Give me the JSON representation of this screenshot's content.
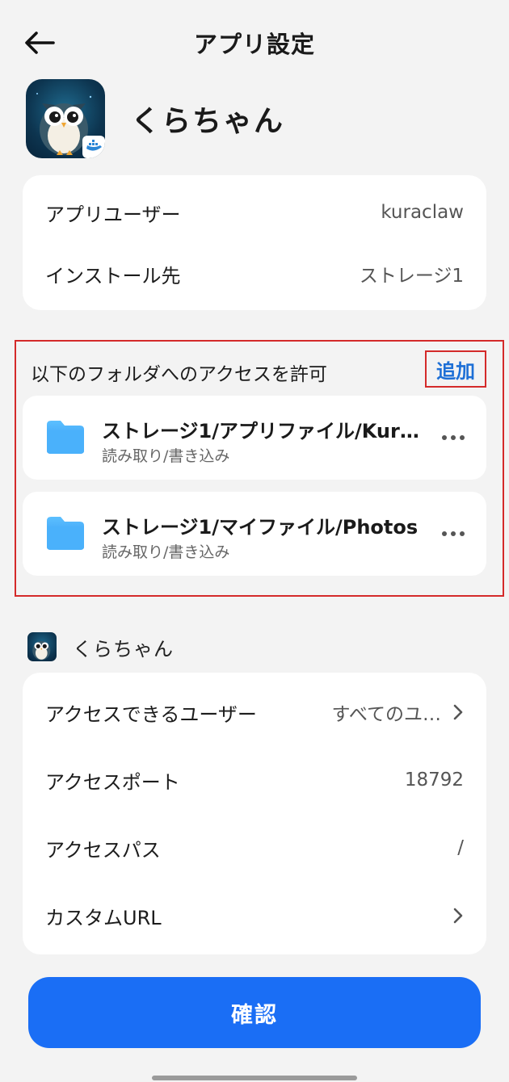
{
  "header": {
    "title": "アプリ設定",
    "back_icon": "arrow-left-icon"
  },
  "app": {
    "name": "くらちゃん",
    "icon": "owl-app-icon"
  },
  "info": {
    "rows": [
      {
        "label": "アプリユーザー",
        "value": "kuraclaw"
      },
      {
        "label": "インストール先",
        "value": "ストレージ1"
      }
    ]
  },
  "folders": {
    "section_title": "以下のフォルダへのアクセスを許可",
    "add_label": "追加",
    "items": [
      {
        "path": "ストレージ1/アプリファイル/Kur…",
        "permission": "読み取り/書き込み"
      },
      {
        "path": "ストレージ1/マイファイル/Photos",
        "permission": "読み取り/書き込み"
      }
    ]
  },
  "access": {
    "app_name": "くらちゃん",
    "rows": [
      {
        "label": "アクセスできるユーザー",
        "value": "すべてのユ…",
        "chevron": true
      },
      {
        "label": "アクセスポート",
        "value": "18792",
        "chevron": false
      },
      {
        "label": "アクセスパス",
        "value": "/",
        "chevron": false
      },
      {
        "label": "カスタムURL",
        "value": "",
        "chevron": true
      }
    ]
  },
  "confirm_label": "確認",
  "colors": {
    "accent": "#1a6ef5",
    "highlight": "#d42a2a",
    "folder": "#3aa8f5",
    "background": "#f3f3f3"
  }
}
